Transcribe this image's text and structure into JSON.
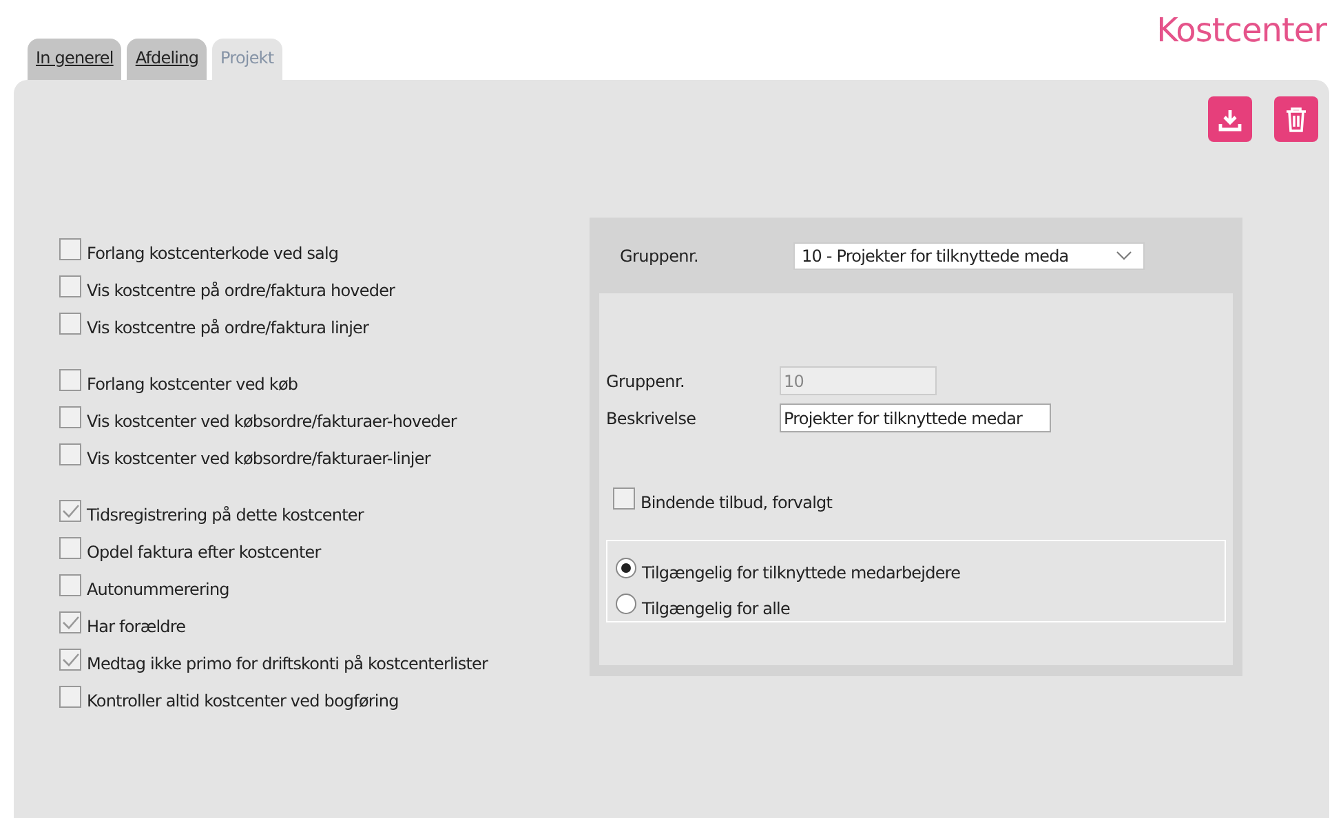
{
  "title": "Kostcenter",
  "tabs": [
    {
      "label": "In generel",
      "selected": false
    },
    {
      "label": "Afdeling",
      "selected": false
    },
    {
      "label": "Projekt",
      "selected": true
    }
  ],
  "toolbar": {
    "buttons": [
      {
        "kind": "download"
      },
      {
        "kind": "delete"
      }
    ]
  },
  "option_groups": [
    {
      "options": [
        {
          "label": "Forlang kostcenterkode ved salg",
          "checked": false
        },
        {
          "label": "Vis kostcentre på ordre/faktura hoveder",
          "checked": false
        },
        {
          "label": "Vis kostcentre på ordre/faktura linjer",
          "checked": false
        }
      ]
    },
    {
      "options": [
        {
          "label": "Forlang kostcenter ved køb",
          "checked": false
        },
        {
          "label": "Vis kostcenter ved købsordre/fakturaer-hoveder",
          "checked": false
        },
        {
          "label": "Vis kostcenter ved købsordre/fakturaer-linjer",
          "checked": false
        }
      ]
    },
    {
      "options": [
        {
          "label": "Tidsregistrering på dette kostcenter",
          "checked": true
        },
        {
          "label": "Opdel faktura efter kostcenter",
          "checked": false
        },
        {
          "label": "Autonummerering",
          "checked": false
        },
        {
          "label": "Har forældre",
          "checked": true
        },
        {
          "label": "Medtag ikke primo for driftskonti på kostcenterlister",
          "checked": true
        },
        {
          "label": "Kontroller altid kostcenter ved bogføring",
          "checked": false
        }
      ]
    }
  ],
  "group_panel": {
    "select_label": "Gruppenr.",
    "select_value": "10 - Projekter for tilknyttede meda",
    "fields": [
      {
        "label": "Gruppenr.",
        "value": "10",
        "disabled": true
      },
      {
        "label": "Beskrivelse",
        "value": "Projekter for tilknyttede medar",
        "disabled": false
      }
    ],
    "checkbox": {
      "label": "Bindende tilbud, forvalgt",
      "checked": false
    },
    "radios": [
      {
        "label": "Tilgængelig for tilknyttede medarbejdere",
        "selected": true
      },
      {
        "label": "Tilgængelig for alle",
        "selected": false
      }
    ]
  }
}
